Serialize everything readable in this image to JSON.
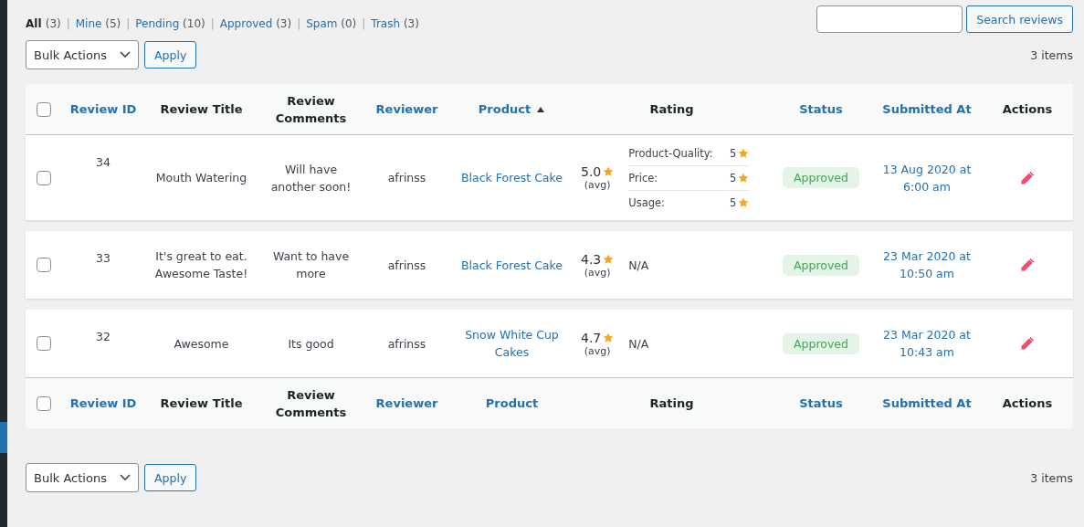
{
  "filters": [
    {
      "label": "All",
      "count": "(3)",
      "selected": true
    },
    {
      "separator": "|",
      "label": "Mine",
      "count": "(5)",
      "selected": false
    },
    {
      "separator": "|",
      "label": "Pending",
      "count": "(10)",
      "selected": false
    },
    {
      "separator": "|",
      "label": "Approved",
      "count": "(3)",
      "selected": false
    },
    {
      "separator": "|",
      "label": "Spam",
      "count": "(0)",
      "selected": false
    },
    {
      "separator": "|",
      "label": "Trash",
      "count": "(3)",
      "selected": false
    }
  ],
  "search": {
    "button": "Search reviews"
  },
  "top_nav": {
    "bulk_actions": "Bulk Actions",
    "apply": "Apply",
    "items_count": "3 items"
  },
  "columns": [
    {
      "label": "Review ID",
      "sortable": true,
      "sorted": false
    },
    {
      "label": "Review Title",
      "sortable": false,
      "sorted": false
    },
    {
      "label": "Review Comments",
      "sortable": false,
      "sorted": false
    },
    {
      "label": "Reviewer",
      "sortable": true,
      "sorted": false
    },
    {
      "label": "Product",
      "sortable": true,
      "sorted": true
    },
    {
      "label": "Rating",
      "sortable": false,
      "sorted": false
    },
    {
      "label": "Status",
      "sortable": true,
      "sorted": false
    },
    {
      "label": "Submitted At",
      "sortable": true,
      "sorted": false
    },
    {
      "label": "Actions",
      "sortable": false,
      "sorted": false
    }
  ],
  "rows": [
    {
      "checked": false,
      "id": "34",
      "title": "Mouth Watering",
      "comments": "Will have another soon!",
      "reviewer": "afrinss",
      "product": "Black Forest Cake",
      "rating": "5.0",
      "avg_label": "(avg)",
      "breakdown": [
        {
          "label": "Product-Quality:",
          "value": "5"
        },
        {
          "label": "Price:",
          "value": "5"
        },
        {
          "label": "Usage:",
          "value": "5"
        }
      ],
      "status": "Approved",
      "submitted": "13 Aug 2020 at 6:00 am"
    },
    {
      "checked": false,
      "id": "33",
      "title": "It's great to eat. Awesome Taste!",
      "comments": "Want to have more",
      "reviewer": "afrinss",
      "product": "Black Forest Cake",
      "rating": "4.3",
      "avg_label": "(avg)",
      "breakdown_text": "N/A",
      "status": "Approved",
      "submitted": "23 Mar 2020 at 10:50 am"
    },
    {
      "checked": false,
      "id": "32",
      "title": "Awesome",
      "comments": "Its good",
      "reviewer": "afrinss",
      "product": "Snow White Cup Cakes",
      "rating": "4.7",
      "avg_label": "(avg)",
      "breakdown_text": "N/A",
      "status": "Approved",
      "submitted": "23 Mar 2020 at 10:43 am"
    }
  ],
  "footer_columns": [
    {
      "label": "Review ID",
      "sortable": true
    },
    {
      "label": "Review Title",
      "sortable": false
    },
    {
      "label": "Review Comments",
      "sortable": false
    },
    {
      "label": "Reviewer",
      "sortable": true
    },
    {
      "label": "Product",
      "sortable": true
    },
    {
      "label": "Rating",
      "sortable": false
    },
    {
      "label": "Status",
      "sortable": true
    },
    {
      "label": "Submitted At",
      "sortable": true
    },
    {
      "label": "Actions",
      "sortable": false
    }
  ],
  "footer_checkbox": {
    "checked": false
  },
  "header_checkbox": {
    "checked": false
  },
  "bottom_nav": {
    "bulk_actions": "Bulk Actions",
    "apply": "Apply",
    "items_count": "3 items"
  }
}
